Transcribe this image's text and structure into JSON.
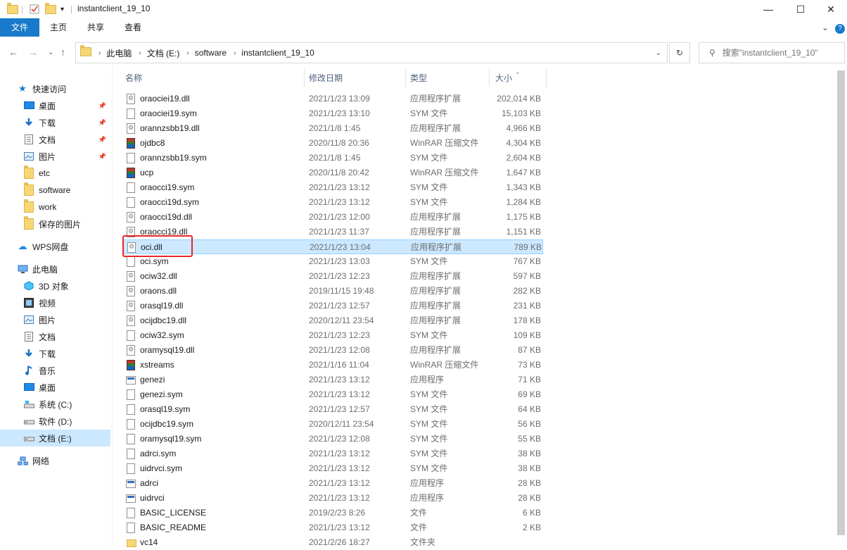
{
  "window": {
    "title": "instantclient_19_10",
    "minimize": "—",
    "maximize": "☐",
    "close": "✕"
  },
  "ribbon": {
    "tabs": [
      "文件",
      "主页",
      "共享",
      "查看"
    ],
    "expand_icon": "⌄",
    "help_icon": "?"
  },
  "address": {
    "crumbs": [
      "此电脑",
      "文档 (E:)",
      "software",
      "instantclient_19_10"
    ],
    "search_placeholder": "搜索\"instantclient_19_10\""
  },
  "sidebar": {
    "quick_access": "快速访问",
    "quick_items": [
      {
        "label": "桌面",
        "icon": "desktop-icon",
        "pinned": true
      },
      {
        "label": "下载",
        "icon": "download-icon",
        "pinned": true
      },
      {
        "label": "文档",
        "icon": "document-icon",
        "pinned": true
      },
      {
        "label": "图片",
        "icon": "picture-icon",
        "pinned": true
      },
      {
        "label": "etc",
        "icon": "folder-icon",
        "pinned": false
      },
      {
        "label": "software",
        "icon": "folder-icon",
        "pinned": false
      },
      {
        "label": "work",
        "icon": "folder-icon",
        "pinned": false
      },
      {
        "label": "保存的图片",
        "icon": "folder-icon",
        "pinned": false
      }
    ],
    "wps": "WPS网盘",
    "this_pc": "此电脑",
    "pc_items": [
      {
        "label": "3D 对象",
        "icon": "3d-objects-icon"
      },
      {
        "label": "视频",
        "icon": "video-icon"
      },
      {
        "label": "图片",
        "icon": "picture-icon"
      },
      {
        "label": "文档",
        "icon": "document-icon"
      },
      {
        "label": "下载",
        "icon": "download-icon"
      },
      {
        "label": "音乐",
        "icon": "music-icon"
      },
      {
        "label": "桌面",
        "icon": "desktop-icon"
      },
      {
        "label": "系统 (C:)",
        "icon": "drive-c-icon"
      },
      {
        "label": "软件 (D:)",
        "icon": "drive-icon"
      },
      {
        "label": "文档 (E:)",
        "icon": "drive-icon",
        "selected": true
      }
    ],
    "network": "网络"
  },
  "columns": {
    "name": "名称",
    "date": "修改日期",
    "type": "类型",
    "size": "大小"
  },
  "files": [
    {
      "name": "oraociei19.dll",
      "date": "2021/1/23 13:09",
      "type": "应用程序扩展",
      "size": "202,014 KB",
      "kind": "dll"
    },
    {
      "name": "oraociei19.sym",
      "date": "2021/1/23 13:10",
      "type": "SYM 文件",
      "size": "15,103 KB",
      "kind": "doc"
    },
    {
      "name": "orannzsbb19.dll",
      "date": "2021/1/8 1:45",
      "type": "应用程序扩展",
      "size": "4,966 KB",
      "kind": "dll"
    },
    {
      "name": "ojdbc8",
      "date": "2020/11/8 20:36",
      "type": "WinRAR 压缩文件",
      "size": "4,304 KB",
      "kind": "rar"
    },
    {
      "name": "orannzsbb19.sym",
      "date": "2021/1/8 1:45",
      "type": "SYM 文件",
      "size": "2,604 KB",
      "kind": "doc"
    },
    {
      "name": "ucp",
      "date": "2020/11/8 20:42",
      "type": "WinRAR 压缩文件",
      "size": "1,647 KB",
      "kind": "rar"
    },
    {
      "name": "oraocci19.sym",
      "date": "2021/1/23 13:12",
      "type": "SYM 文件",
      "size": "1,343 KB",
      "kind": "doc"
    },
    {
      "name": "oraocci19d.sym",
      "date": "2021/1/23 13:12",
      "type": "SYM 文件",
      "size": "1,284 KB",
      "kind": "doc"
    },
    {
      "name": "oraocci19d.dll",
      "date": "2021/1/23 12:00",
      "type": "应用程序扩展",
      "size": "1,175 KB",
      "kind": "dll"
    },
    {
      "name": "oraocci19.dll",
      "date": "2021/1/23 11:37",
      "type": "应用程序扩展",
      "size": "1,151 KB",
      "kind": "dll"
    },
    {
      "name": "oci.dll",
      "date": "2021/1/23 13:04",
      "type": "应用程序扩展",
      "size": "789 KB",
      "kind": "dll",
      "selected": true
    },
    {
      "name": "oci.sym",
      "date": "2021/1/23 13:03",
      "type": "SYM 文件",
      "size": "767 KB",
      "kind": "doc"
    },
    {
      "name": "ociw32.dll",
      "date": "2021/1/23 12:23",
      "type": "应用程序扩展",
      "size": "597 KB",
      "kind": "dll"
    },
    {
      "name": "oraons.dll",
      "date": "2019/11/15 19:48",
      "type": "应用程序扩展",
      "size": "282 KB",
      "kind": "dll"
    },
    {
      "name": "orasql19.dll",
      "date": "2021/1/23 12:57",
      "type": "应用程序扩展",
      "size": "231 KB",
      "kind": "dll"
    },
    {
      "name": "ocijdbc19.dll",
      "date": "2020/12/11 23:54",
      "type": "应用程序扩展",
      "size": "178 KB",
      "kind": "dll"
    },
    {
      "name": "ociw32.sym",
      "date": "2021/1/23 12:23",
      "type": "SYM 文件",
      "size": "109 KB",
      "kind": "doc"
    },
    {
      "name": "oramysql19.dll",
      "date": "2021/1/23 12:08",
      "type": "应用程序扩展",
      "size": "87 KB",
      "kind": "dll"
    },
    {
      "name": "xstreams",
      "date": "2021/1/16 11:04",
      "type": "WinRAR 压缩文件",
      "size": "73 KB",
      "kind": "rar"
    },
    {
      "name": "genezi",
      "date": "2021/1/23 13:12",
      "type": "应用程序",
      "size": "71 KB",
      "kind": "exe"
    },
    {
      "name": "genezi.sym",
      "date": "2021/1/23 13:12",
      "type": "SYM 文件",
      "size": "69 KB",
      "kind": "doc"
    },
    {
      "name": "orasql19.sym",
      "date": "2021/1/23 12:57",
      "type": "SYM 文件",
      "size": "64 KB",
      "kind": "doc"
    },
    {
      "name": "ocijdbc19.sym",
      "date": "2020/12/11 23:54",
      "type": "SYM 文件",
      "size": "56 KB",
      "kind": "doc"
    },
    {
      "name": "oramysql19.sym",
      "date": "2021/1/23 12:08",
      "type": "SYM 文件",
      "size": "55 KB",
      "kind": "doc"
    },
    {
      "name": "adrci.sym",
      "date": "2021/1/23 13:12",
      "type": "SYM 文件",
      "size": "38 KB",
      "kind": "doc"
    },
    {
      "name": "uidrvci.sym",
      "date": "2021/1/23 13:12",
      "type": "SYM 文件",
      "size": "38 KB",
      "kind": "doc"
    },
    {
      "name": "adrci",
      "date": "2021/1/23 13:12",
      "type": "应用程序",
      "size": "28 KB",
      "kind": "exe"
    },
    {
      "name": "uidrvci",
      "date": "2021/1/23 13:12",
      "type": "应用程序",
      "size": "28 KB",
      "kind": "exe"
    },
    {
      "name": "BASIC_LICENSE",
      "date": "2019/2/23 8:26",
      "type": "文件",
      "size": "6 KB",
      "kind": "doc"
    },
    {
      "name": "BASIC_README",
      "date": "2021/1/23 13:12",
      "type": "文件",
      "size": "2 KB",
      "kind": "doc"
    },
    {
      "name": "vc14",
      "date": "2021/2/26 18:27",
      "type": "文件夹",
      "size": "",
      "kind": "folder"
    }
  ],
  "colors": {
    "accent": "#1979ca",
    "selection": "#cce8ff",
    "highlight_box": "#e8262b"
  }
}
